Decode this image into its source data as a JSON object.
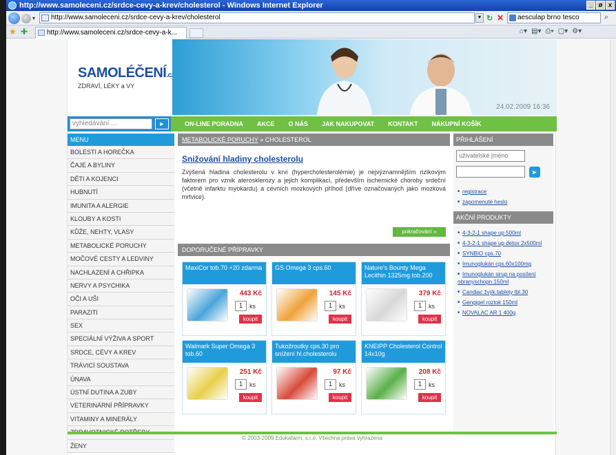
{
  "browser": {
    "title": "http://www.samoleceni.cz/srdce-cevy-a-krev/cholesterol - Windows Internet Explorer",
    "window_buttons": [
      "_",
      "ø",
      "x"
    ],
    "url": "http://www.samoleceni.cz/srdce-cevy-a-krev/cholesterol",
    "search_value": "aesculap brno tesco",
    "tab_label": "http://www.samoleceni.cz/srdce-cevy-a-k..."
  },
  "header": {
    "logo": "SAMOLÉČENÍ",
    "logo_suffix": ".cz",
    "tagline": "ZDRAVÍ, LÉKY a VY",
    "date": "24.02.2009 16:36"
  },
  "nav": {
    "search_placeholder": "vyhledávání ...",
    "search_go": "►",
    "links": [
      "ON-LINE PORADNA",
      "AKCE",
      "O NÁS",
      "JAK NAKUPOVAT",
      "KONTAKT",
      "NÁKUPNÍ KOŠÍK"
    ]
  },
  "menu": {
    "head": "MENU",
    "items": [
      "BOLESTI A HOREČKA",
      "ČAJE A BYLINY",
      "DĚTI A KOJENCI",
      "HUBNUTÍ",
      "IMUNITA A ALERGIE",
      "KLOUBY A KOSTI",
      "KŮŽE, NEHTY, VLASY",
      "METABOLICKÉ PORUCHY",
      "MOČOVÉ CESTY A LEDVINY",
      "NACHLAZENÍ A CHŘIPKA",
      "NERVY A PSYCHIKA",
      "OČI A UŠI",
      "PARAZITI",
      "SEX",
      "SPECIÁLNÍ VÝŽIVA A SPORT",
      "SRDCE, CÉVY A KREV",
      "TRÁVICÍ SOUSTAVA",
      "ÚNAVA",
      "ÚSTNÍ DUTINA A ZUBY",
      "VETERINÁRNÍ PŘÍPRAVKY",
      "VITAMINY A MINERÁLY",
      "ZDRAVOTNICKÉ POTŘEBY",
      "ŽENY"
    ]
  },
  "content": {
    "breadcrumb_link": "METABOLICKÉ PORUCHY",
    "breadcrumb_sep": "»",
    "breadcrumb_current": "CHOLESTEROL",
    "article_title": "Snižování hladiny cholesterolu",
    "article_text": "Zvýšená hladina cholesterolu v krvi (hypercholesterolémie) je nejvýznamnějším rizikovým faktorem pro vznik aterosklerozy a jejich komplikací, především ischemické choroby srdeční (včetně infarktu myokardu) a cévních mozkových příhod (dříve označovaných jako mozková mrtvice).",
    "more_button": "pokračování »",
    "recommended_head": "DOPORUČENÉ PŘÍPRAVKY",
    "qty_unit": "ks",
    "buy_label": "koupit",
    "products": [
      {
        "name": "MaxiCor tob.70 +20 zdarma",
        "price": "443 Kč",
        "qty": "1",
        "color": "#4aa4d8"
      },
      {
        "name": "GS Omega 3 cps.60",
        "price": "145 Kč",
        "qty": "1",
        "color": "#f0a23a"
      },
      {
        "name": "Nature's Bounty Mega Lecithin 1325mg tob.200",
        "price": "379 Kč",
        "qty": "1",
        "color": "#d8d8d8"
      },
      {
        "name": "Walmark Super Omega 3 tob.60",
        "price": "251 Kč",
        "qty": "1",
        "color": "#e8d04a"
      },
      {
        "name": "Tukožroutky cps.30 pro snížení hl.cholesterolu",
        "price": "97 Kč",
        "qty": "1",
        "color": "#d84a3a"
      },
      {
        "name": "KNEIPP Cholesterol Control 14x10g",
        "price": "208 Kč",
        "qty": "1",
        "color": "#5ab04a"
      }
    ]
  },
  "sidebar": {
    "login_head": "PŘIHLÁŠENÍ",
    "username_placeholder": "uživatelské jméno",
    "go": "►",
    "links": [
      "registrace",
      "zapomenuté heslo"
    ],
    "offers_head": "AKČNÍ PRODUKTY",
    "offers": [
      "4-3-2-1 shape up 500ml",
      "4-3-2-1 shape up detox 2x500ml",
      "SYNBIO cps.70",
      "Imunoglukán cps.60x100mg",
      "Imunoglukán sirup na posílení obranyschopn.150ml",
      "Candiac žvýk.tablety tbl.30",
      "Gengigel roztok 150ml",
      "NOVALAC AR 1 400g"
    ]
  },
  "footer": {
    "text": "© 2003-2009 Edukafarm, s.r.o. Všechna práva vyhrazena"
  },
  "colors": {
    "brand_blue": "#1f9bdc",
    "nav_green": "#6fc043",
    "buy_red": "#e2314a",
    "price_red": "#d2232a"
  }
}
